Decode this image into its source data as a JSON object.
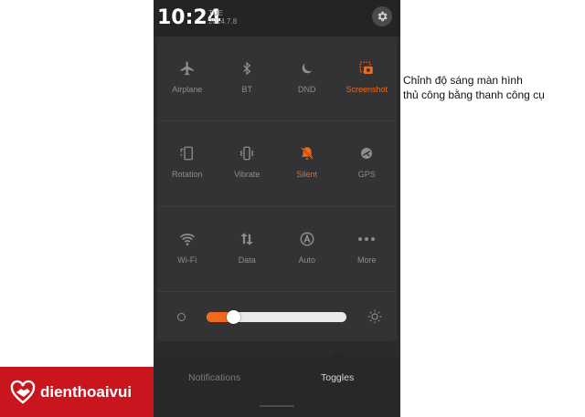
{
  "status": {
    "time": "10:24",
    "weekday": "TUE",
    "date": "2014.7.8"
  },
  "toggles": [
    [
      {
        "label": "Airplane",
        "icon": "airplane-icon",
        "active": false
      },
      {
        "label": "BT",
        "icon": "bluetooth-icon",
        "active": false
      },
      {
        "label": "DND",
        "icon": "moon-icon",
        "active": false
      },
      {
        "label": "Screenshot",
        "icon": "screenshot-icon",
        "active": true
      }
    ],
    [
      {
        "label": "Rotation",
        "icon": "rotation-icon",
        "active": false
      },
      {
        "label": "Vibrate",
        "icon": "vibrate-icon",
        "active": false
      },
      {
        "label": "Silent",
        "icon": "bell-off-icon",
        "active": true
      },
      {
        "label": "GPS",
        "icon": "gps-icon",
        "active": false
      }
    ],
    [
      {
        "label": "Wi-Fi",
        "icon": "wifi-icon",
        "active": false
      },
      {
        "label": "Data",
        "icon": "data-arrows-icon",
        "active": false
      },
      {
        "label": "Auto",
        "icon": "auto-icon",
        "active": false
      },
      {
        "label": "More",
        "icon": "more-dots-icon",
        "active": false
      }
    ]
  ],
  "brightness": {
    "level": 0.19
  },
  "footer": {
    "tab_notifications": "Notifications",
    "tab_toggles": "Toggles"
  },
  "caption": {
    "line1": "Chỉnh độ sáng màn hình",
    "line2": "thủ công bằng thanh công cụ"
  },
  "logo": {
    "text": "dienthoaivui"
  },
  "colors": {
    "accent": "#ef6a1d",
    "icon_inactive": "#8d8d8f",
    "logo_bg": "#c9151e"
  }
}
